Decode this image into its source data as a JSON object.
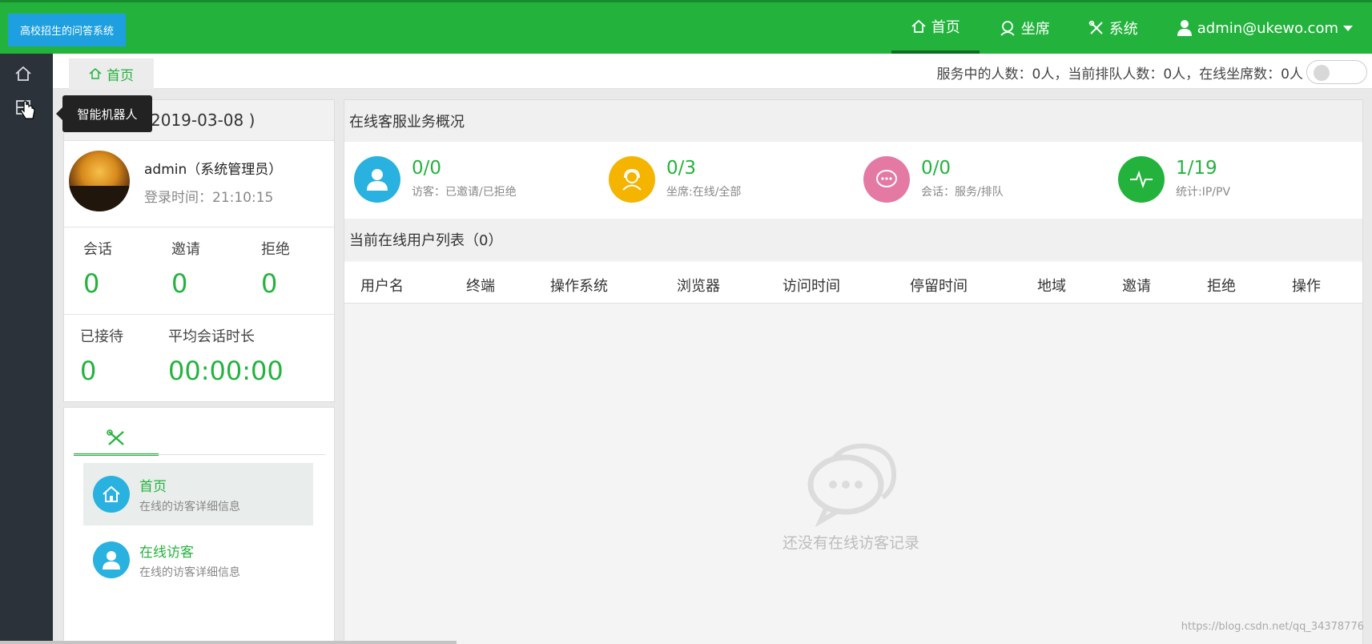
{
  "brand": {
    "title": "高校招生的问答系统"
  },
  "topnav": {
    "home": "首页",
    "seats": "坐席",
    "system": "系统",
    "user": "admin@ukewo.com"
  },
  "leftbar": {
    "tooltip": "智能机器人"
  },
  "breadcrumb": {
    "home": "首页"
  },
  "status_text": "服务中的人数：0人，当前排队人数：0人，在线坐席数：0人",
  "profile": {
    "date_header": "2019-03-08 )",
    "name": "admin（系统管理员）",
    "login_time": "登录时间：21:10:15",
    "stats": [
      {
        "label": "会话",
        "value": "0"
      },
      {
        "label": "邀请",
        "value": "0"
      },
      {
        "label": "拒绝",
        "value": "0"
      }
    ],
    "received_label": "已接待",
    "received_value": "0",
    "avg_label": "平均会话时长",
    "avg_value": "00:00:00"
  },
  "menu": {
    "items": [
      {
        "title": "首页",
        "sub": "在线的访客详细信息"
      },
      {
        "title": "在线访客",
        "sub": "在线的访客详细信息"
      }
    ]
  },
  "overview": {
    "title": "在线客服业务概况",
    "items": [
      {
        "num": "0/0",
        "sub": "访客：已邀请/已拒绝",
        "color": "#29b1df",
        "icon": "user-icon"
      },
      {
        "num": "0/3",
        "sub": "坐席:在线/全部",
        "color": "#f4b400",
        "icon": "headset-icon"
      },
      {
        "num": "0/0",
        "sub": "会话：服务/排队",
        "color": "#e47aa4",
        "icon": "chat-icon"
      },
      {
        "num": "1/19",
        "sub": "统计:IP/PV",
        "color": "#23b33d",
        "icon": "pulse-icon"
      }
    ]
  },
  "online_list": {
    "title": "当前在线用户列表（0）",
    "columns": [
      "用户名",
      "终端",
      "操作系统",
      "浏览器",
      "访问时间",
      "停留时间",
      "地域",
      "邀请",
      "拒绝",
      "操作"
    ],
    "empty_text": "还没有在线访客记录"
  },
  "watermark": "https://blog.csdn.net/qq_34378776"
}
